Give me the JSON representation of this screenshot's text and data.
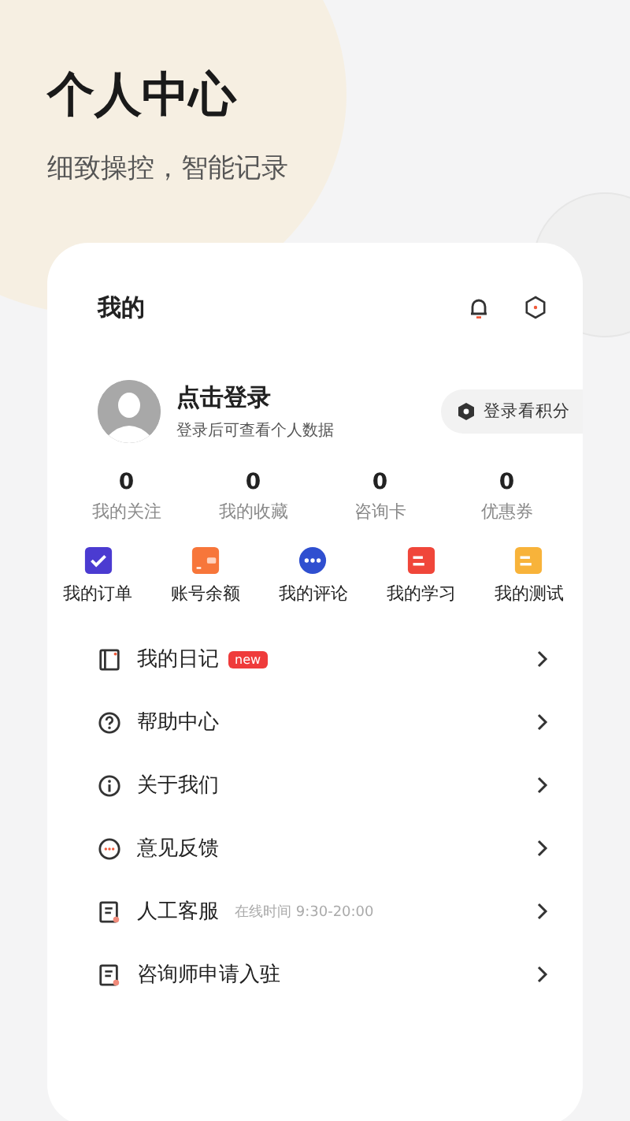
{
  "header": {
    "title": "个人中心",
    "subtitle": "细致操控，智能记录"
  },
  "card": {
    "title": "我的",
    "profile": {
      "name": "点击登录",
      "hint": "登录后可查看个人数据",
      "points_button": "登录看积分"
    },
    "stats": [
      {
        "value": "0",
        "label": "我的关注"
      },
      {
        "value": "0",
        "label": "我的收藏"
      },
      {
        "value": "0",
        "label": "咨询卡"
      },
      {
        "value": "0",
        "label": "优惠券"
      }
    ],
    "shortcuts": [
      {
        "label": "我的订单",
        "kind": "check",
        "color": "#4b3bd1"
      },
      {
        "label": "账号余额",
        "kind": "wallet",
        "color": "#f7763a"
      },
      {
        "label": "我的评论",
        "kind": "dots",
        "color": "#2f4fd0"
      },
      {
        "label": "我的学习",
        "kind": "lines",
        "color": "#f0463a"
      },
      {
        "label": "我的测试",
        "kind": "lines",
        "color": "#f8b33a"
      }
    ],
    "menu": [
      {
        "label": "我的日记",
        "kind": "book",
        "badge": "new"
      },
      {
        "label": "帮助中心",
        "kind": "help"
      },
      {
        "label": "关于我们",
        "kind": "info"
      },
      {
        "label": "意见反馈",
        "kind": "chat"
      },
      {
        "label": "人工客服",
        "kind": "doc",
        "note": "在线时间 9:30-20:00"
      },
      {
        "label": "咨询师申请入驻",
        "kind": "doc"
      }
    ]
  }
}
